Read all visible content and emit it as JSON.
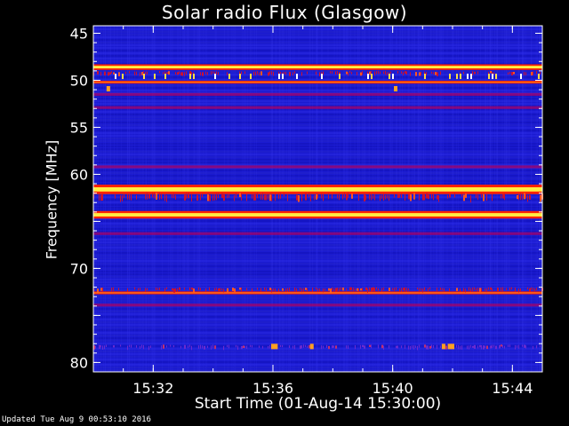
{
  "chart_data": {
    "type": "heatmap",
    "title": "Solar radio Flux (Glasgow)",
    "xlabel": "Start Time (01-Aug-14 15:30:00)",
    "ylabel": "Frequency [MHz]",
    "x_ticks": [
      "15:32",
      "15:36",
      "15:40",
      "15:44"
    ],
    "x_tick_minutes": [
      2,
      6,
      10,
      14
    ],
    "xlim_minutes": [
      0,
      15
    ],
    "y_ticks": [
      45,
      50,
      55,
      60,
      65,
      70,
      75,
      80
    ],
    "y_tick_labels": [
      "45",
      "50",
      "55",
      "60",
      "",
      "70",
      "",
      "80"
    ],
    "ylim": [
      44.2,
      81.0
    ],
    "y_inverted": true,
    "background_color": "#1a1ad0",
    "bands": [
      {
        "freq": 48.6,
        "width": 0.3,
        "intensity": "high"
      },
      {
        "freq": 49.2,
        "width": 0.4,
        "intensity": "medium-spotty"
      },
      {
        "freq": 50.2,
        "width": 0.3,
        "intensity": "high-red"
      },
      {
        "freq": 51.5,
        "width": 0.3,
        "intensity": "medium"
      },
      {
        "freq": 52.9,
        "width": 0.3,
        "intensity": "medium"
      },
      {
        "freq": 59.2,
        "width": 0.3,
        "intensity": "medium"
      },
      {
        "freq": 61.6,
        "width": 0.5,
        "intensity": "high"
      },
      {
        "freq": 62.3,
        "width": 0.7,
        "intensity": "medium-spotty"
      },
      {
        "freq": 64.3,
        "width": 0.4,
        "intensity": "high"
      },
      {
        "freq": 66.3,
        "width": 0.3,
        "intensity": "medium"
      },
      {
        "freq": 72.6,
        "width": 0.3,
        "intensity": "high-red"
      },
      {
        "freq": 72.2,
        "width": 0.4,
        "intensity": "medium-spotty"
      },
      {
        "freq": 73.9,
        "width": 0.3,
        "intensity": "medium"
      },
      {
        "freq": 78.3,
        "width": 0.4,
        "intensity": "low-spotty"
      }
    ],
    "bursts": [
      {
        "t": 0.5,
        "freq": 50.9
      },
      {
        "t": 10.1,
        "freq": 50.9
      },
      {
        "t": 6.0,
        "freq": 78.3
      },
      {
        "t": 6.1,
        "freq": 78.3
      },
      {
        "t": 7.3,
        "freq": 78.3
      },
      {
        "t": 11.7,
        "freq": 78.3
      },
      {
        "t": 11.9,
        "freq": 78.3
      },
      {
        "t": 12.0,
        "freq": 78.3
      }
    ]
  },
  "footer": "Updated Tue Aug  9 00:53:10 2016"
}
